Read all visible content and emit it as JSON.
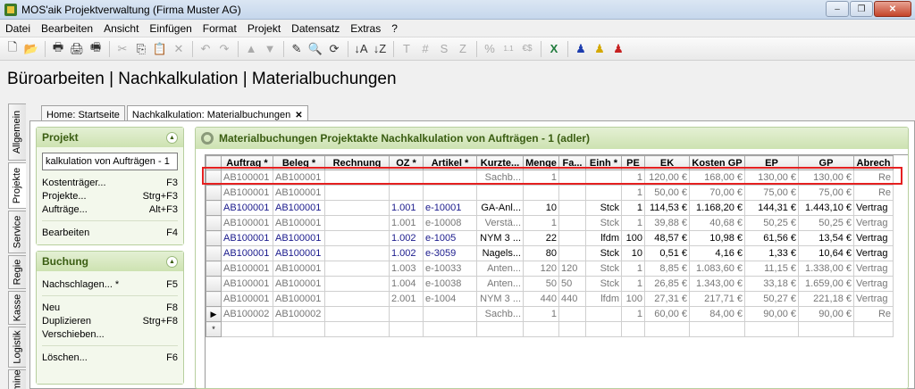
{
  "window": {
    "title": "MOS'aik Projektverwaltung (Firma Muster AG)",
    "controls": [
      "–",
      "❐",
      "✕"
    ]
  },
  "menu": [
    "Datei",
    "Bearbeiten",
    "Ansicht",
    "Einfügen",
    "Format",
    "Projekt",
    "Datensatz",
    "Extras",
    "?"
  ],
  "toolbar": {
    "icons": [
      "new-file-icon",
      "open-folder-icon",
      "print-icon",
      "print-preview-icon",
      "print-settings-icon",
      "cut-icon",
      "copy-icon",
      "paste-icon",
      "delete-icon",
      "undo-icon",
      "redo-icon",
      "move-up-icon",
      "move-down-icon",
      "edit-pencil-icon",
      "find-icon",
      "refresh-icon",
      "sort-az-icon",
      "sort-za-icon",
      "text-format-icon",
      "hash-icon",
      "sum-icon",
      "currency-icon",
      "percent-icon",
      "numbering-icon",
      "euro-convert-icon",
      "excel-export-icon",
      "user-blue-icon",
      "user-yellow-icon",
      "user-red-icon"
    ],
    "glyphs": [
      "🗋",
      "📂",
      "🖶",
      "🖨",
      "🖷",
      "✂",
      "⎘",
      "📋",
      "✕",
      "↶",
      "↷",
      "▲",
      "▼",
      "✎",
      "🔍",
      "⟳",
      "↓A",
      "↓Z",
      "T",
      "#",
      "S",
      "Z",
      "%",
      "1.1",
      "€$",
      "X",
      "♟",
      "♟",
      "♟"
    ]
  },
  "page_title": "Büroarbeiten | Nachkalkulation | Materialbuchungen",
  "side_tabs": [
    "Allgemein",
    "Projekte",
    "Service",
    "Regie",
    "Kasse",
    "Logistik",
    "Termine"
  ],
  "doc_tabs": [
    {
      "label": "Home: Startseite"
    },
    {
      "label": "Nachkalkulation: Materialbuchungen",
      "close": "✕"
    }
  ],
  "projekt_group": {
    "title": "Projekt",
    "search_value": "kalkulation von Aufträgen - 1",
    "items": [
      {
        "label": "Kostenträger...",
        "shortcut": "F3"
      },
      {
        "label": "Projekte...",
        "shortcut": "Strg+F3"
      },
      {
        "label": "Aufträge...",
        "shortcut": "Alt+F3"
      },
      {
        "label": "Bearbeiten",
        "shortcut": "F4"
      }
    ]
  },
  "buchung_group": {
    "title": "Buchung",
    "items": [
      {
        "label": "Nachschlagen... *",
        "shortcut": "F5"
      },
      {
        "label": "Neu",
        "shortcut": "F8"
      },
      {
        "label": "Duplizieren",
        "shortcut": "Strg+F8"
      },
      {
        "label": "Verschieben...",
        "shortcut": ""
      },
      {
        "label": "Löschen...",
        "shortcut": "F6"
      }
    ]
  },
  "panel_title": "Materialbuchungen Projektakte Nachkalkulation von Aufträgen - 1 (adler)",
  "grid": {
    "columns": [
      "Auftrag *",
      "Beleg *",
      "Rechnung",
      "OZ *",
      "Artikel *",
      "Kurzte...",
      "Menge",
      "Fa...",
      "Einh *",
      "PE",
      "EK",
      "Kosten GP",
      "EP",
      "GP",
      "Abrech"
    ],
    "rows": [
      {
        "style": "gray",
        "cells": [
          "AB100001",
          "AB100001",
          "",
          "",
          "",
          "Sachb...",
          "1",
          "",
          "",
          "1",
          "120,00 €",
          "168,00 €",
          "130,00 €",
          "130,00 €",
          "Re"
        ]
      },
      {
        "style": "gray",
        "cells": [
          "AB100001",
          "AB100001",
          "",
          "",
          "",
          "",
          "",
          "",
          "",
          "1",
          "50,00 €",
          "70,00 €",
          "75,00 €",
          "75,00 €",
          "Re"
        ]
      },
      {
        "style": "blue",
        "cells": [
          "AB100001",
          "AB100001",
          "",
          "1.001",
          "e-10001",
          "GA-Anl...",
          "10",
          "",
          "Stck",
          "1",
          "114,53 €",
          "1.168,20 €",
          "144,31 €",
          "1.443,10 €",
          "Vertrag"
        ]
      },
      {
        "style": "gray",
        "cells": [
          "AB100001",
          "AB100001",
          "",
          "1.001",
          "e-10008",
          "Verstä...",
          "1",
          "",
          "Stck",
          "1",
          "39,88 €",
          "40,68 €",
          "50,25 €",
          "50,25 €",
          "Vertrag"
        ]
      },
      {
        "style": "blue",
        "cells": [
          "AB100001",
          "AB100001",
          "",
          "1.002",
          "e-1005",
          "NYM 3 ...",
          "22",
          "",
          "lfdm",
          "100",
          "48,57 €",
          "10,98 €",
          "61,56 €",
          "13,54 €",
          "Vertrag"
        ]
      },
      {
        "style": "blue",
        "cells": [
          "AB100001",
          "AB100001",
          "",
          "1.002",
          "e-3059",
          "Nagels...",
          "80",
          "",
          "Stck",
          "10",
          "0,51 €",
          "4,16 €",
          "1,33 €",
          "10,64 €",
          "Vertrag"
        ]
      },
      {
        "style": "gray",
        "cells": [
          "AB100001",
          "AB100001",
          "",
          "1.003",
          "e-10033",
          "Anten...",
          "120",
          "120",
          "Stck",
          "1",
          "8,85 €",
          "1.083,60 €",
          "11,15 €",
          "1.338,00 €",
          "Vertrag"
        ]
      },
      {
        "style": "gray",
        "cells": [
          "AB100001",
          "AB100001",
          "",
          "1.004",
          "e-10038",
          "Anten...",
          "50",
          "50",
          "Stck",
          "1",
          "26,85 €",
          "1.343,00 €",
          "33,18 €",
          "1.659,00 €",
          "Vertrag"
        ]
      },
      {
        "style": "gray",
        "cells": [
          "AB100001",
          "AB100001",
          "",
          "2.001",
          "e-1004",
          "NYM 3 ...",
          "440",
          "440",
          "lfdm",
          "100",
          "27,31 €",
          "217,71 €",
          "50,27 €",
          "221,18 €",
          "Vertrag"
        ]
      },
      {
        "style": "gray",
        "current": "▶",
        "cells": [
          "AB100002",
          "AB100002",
          "",
          "",
          "",
          "Sachb...",
          "1",
          "",
          "",
          "1",
          "60,00 €",
          "84,00 €",
          "90,00 €",
          "90,00 €",
          "Re"
        ]
      }
    ],
    "new_row_marker": "*"
  }
}
